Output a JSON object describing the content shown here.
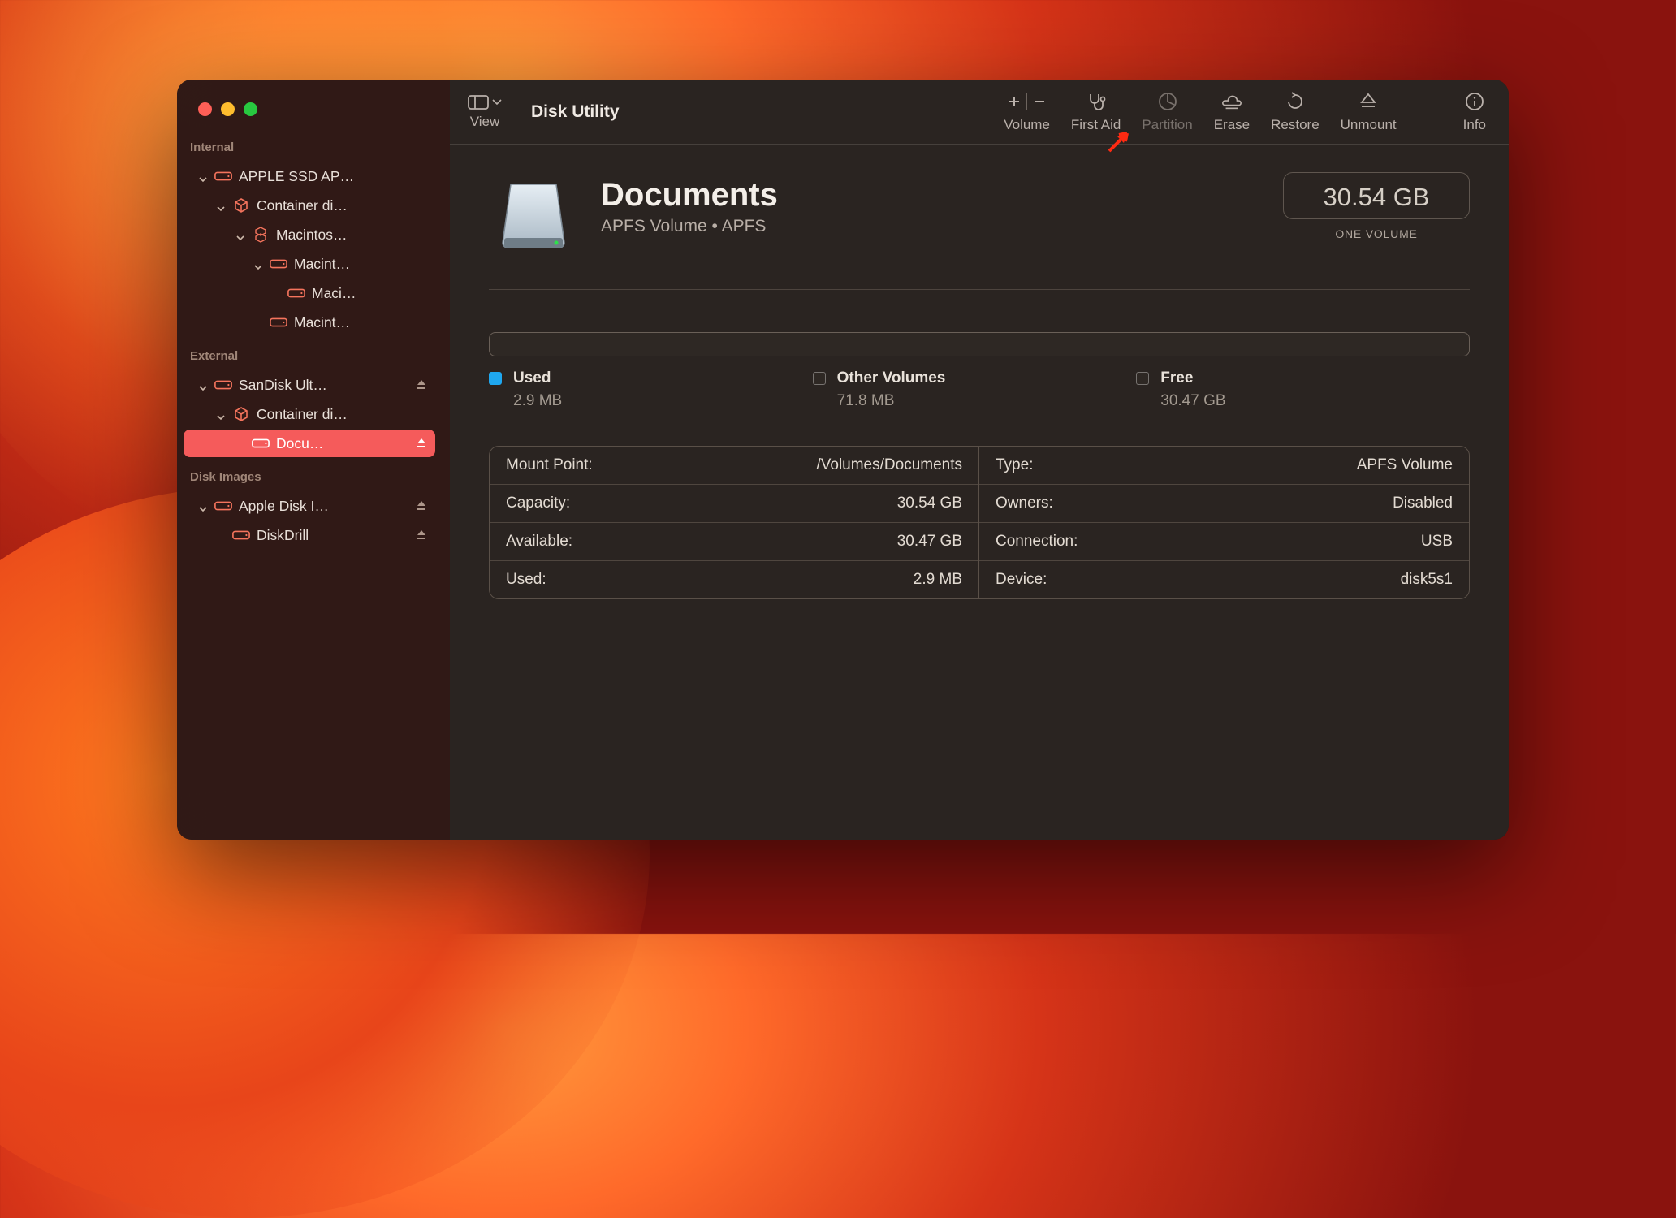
{
  "app_title": "Disk Utility",
  "toolbar": {
    "view_label": "View",
    "volume_label": "Volume",
    "first_aid_label": "First Aid",
    "partition_label": "Partition",
    "erase_label": "Erase",
    "restore_label": "Restore",
    "unmount_label": "Unmount",
    "info_label": "Info"
  },
  "sidebar": {
    "sections": {
      "internal": "Internal",
      "external": "External",
      "disk_images": "Disk Images"
    },
    "internal": [
      {
        "label": "APPLE SSD AP…",
        "icon": "disk",
        "color": "#f5745d"
      },
      {
        "label": "Container di…",
        "icon": "cube",
        "color": "#f5745d"
      },
      {
        "label": "Macintos…",
        "icon": "cubes",
        "color": "#f5745d"
      },
      {
        "label": "Macint…",
        "icon": "disk",
        "color": "#f5745d"
      },
      {
        "label": "Maci…",
        "icon": "disk",
        "color": "#f5745d"
      },
      {
        "label": "Macint…",
        "icon": "disk",
        "color": "#f5745d"
      }
    ],
    "external": [
      {
        "label": "SanDisk Ult…",
        "icon": "disk",
        "color": "#f5745d"
      },
      {
        "label": "Container di…",
        "icon": "cube",
        "color": "#f5745d"
      },
      {
        "label": "Docu…",
        "icon": "disk",
        "color": "#ffffff",
        "selected": true
      }
    ],
    "disk_images": [
      {
        "label": "Apple Disk I…",
        "icon": "disk",
        "color": "#f5745d"
      },
      {
        "label": "DiskDrill",
        "icon": "disk",
        "color": "#f5745d"
      }
    ]
  },
  "volume": {
    "name": "Documents",
    "subtitle": "APFS Volume • APFS",
    "capacity_card": "30.54 GB",
    "one_volume": "ONE VOLUME"
  },
  "usage": {
    "used_label": "Used",
    "used_value": "2.9 MB",
    "other_label": "Other Volumes",
    "other_value": "71.8 MB",
    "free_label": "Free",
    "free_value": "30.47 GB"
  },
  "info": {
    "left": [
      {
        "k": "Mount Point:",
        "v": "/Volumes/Documents"
      },
      {
        "k": "Capacity:",
        "v": "30.54 GB"
      },
      {
        "k": "Available:",
        "v": "30.47 GB"
      },
      {
        "k": "Used:",
        "v": "2.9 MB"
      }
    ],
    "right": [
      {
        "k": "Type:",
        "v": "APFS Volume"
      },
      {
        "k": "Owners:",
        "v": "Disabled"
      },
      {
        "k": "Connection:",
        "v": "USB"
      },
      {
        "k": "Device:",
        "v": "disk5s1"
      }
    ]
  }
}
